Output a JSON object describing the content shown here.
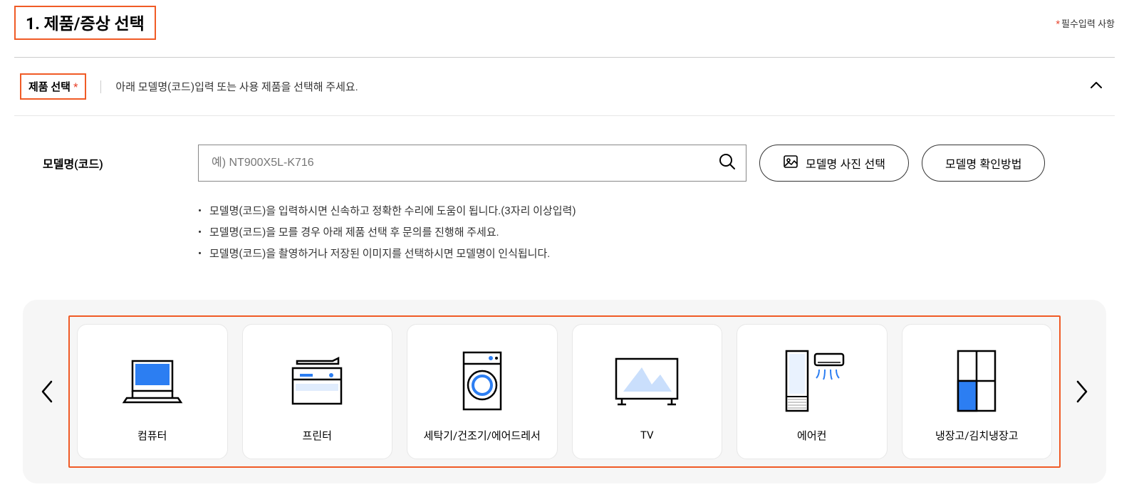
{
  "header": {
    "step_title": "1. 제품/증상 선택",
    "required_note": "필수입력 사항"
  },
  "section": {
    "label": "제품 선택",
    "desc": "아래 모델명(코드)입력 또는 사용 제품을 선택해 주세요."
  },
  "model": {
    "label": "모델명(코드)",
    "placeholder": "예) NT900X5L-K716",
    "photo_btn": "모델명 사진 선택",
    "check_btn": "모델명 확인방법"
  },
  "help": {
    "items": [
      "모델명(코드)을 입력하시면 신속하고 정확한 수리에 도움이 됩니다.(3자리 이상입력)",
      "모델명(코드)을 모를 경우 아래 제품 선택 후 문의를 진행해 주세요.",
      "모델명(코드)을 촬영하거나 저장된 이미지를 선택하시면 모델명이 인식됩니다."
    ]
  },
  "categories": [
    {
      "label": "컴퓨터",
      "icon": "laptop"
    },
    {
      "label": "프린터",
      "icon": "printer"
    },
    {
      "label": "세탁기/건조기/에어드레서",
      "icon": "washer"
    },
    {
      "label": "TV",
      "icon": "tv"
    },
    {
      "label": "에어컨",
      "icon": "aircon"
    },
    {
      "label": "냉장고/김치냉장고",
      "icon": "fridge"
    }
  ]
}
